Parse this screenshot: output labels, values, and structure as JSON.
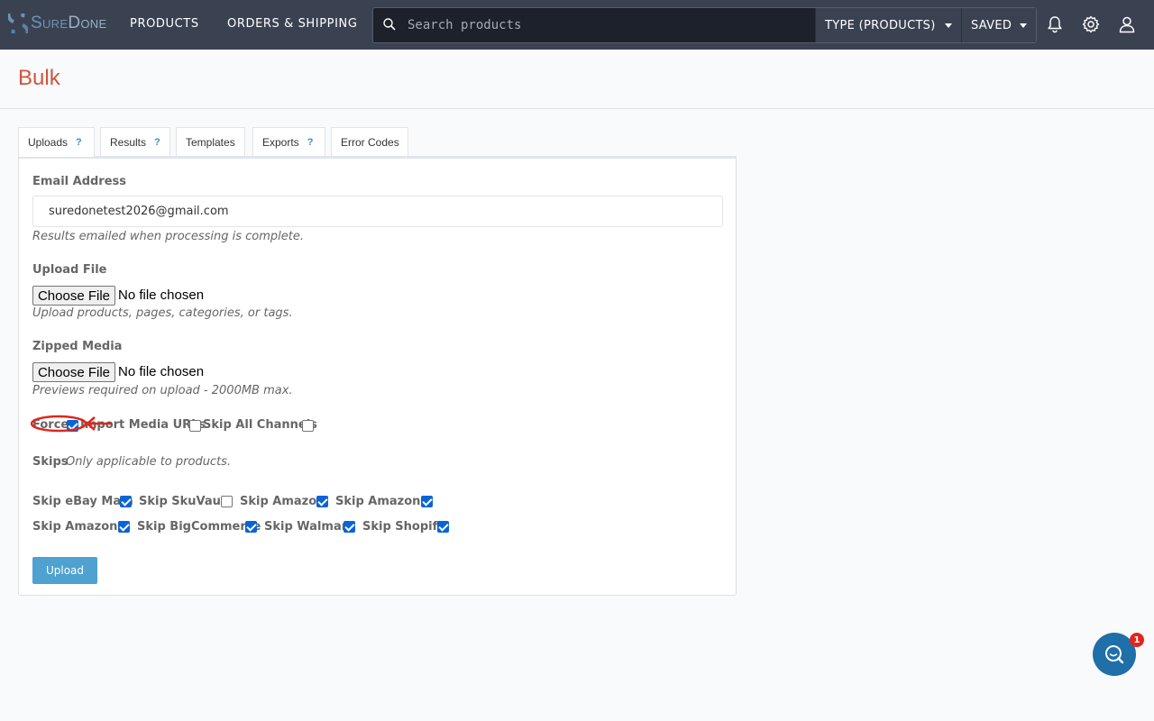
{
  "brand": {
    "name_part1": "Sure",
    "name_part2": "Done"
  },
  "nav": {
    "items": [
      {
        "label": "PRODUCTS"
      },
      {
        "label": "ORDERS & SHIPPING"
      }
    ],
    "search": {
      "placeholder": "Search products",
      "value": ""
    },
    "type_dropdown": {
      "label": "TYPE (PRODUCTS)"
    },
    "saved_dropdown": {
      "label": "SAVED"
    },
    "icons": [
      "bell-icon",
      "gear-icon",
      "user-icon"
    ]
  },
  "page": {
    "title": "Bulk"
  },
  "tabs": [
    {
      "label": "Uploads",
      "help": "?"
    },
    {
      "label": "Results",
      "help": "?"
    },
    {
      "label": "Templates"
    },
    {
      "label": "Exports",
      "help": "?"
    },
    {
      "label": "Error Codes"
    }
  ],
  "form": {
    "email": {
      "label": "Email Address",
      "value": "suredonetest2026@gmail.com",
      "help": "Results emailed when processing is complete."
    },
    "upload_file": {
      "label": "Upload File",
      "button": "Choose File",
      "status": "No file chosen",
      "help": "Upload products, pages, categories, or tags."
    },
    "zipped_media": {
      "label": "Zipped Media",
      "button": "Choose File",
      "status": "No file chosen",
      "help": "Previews required on upload - 2000MB max."
    },
    "options": [
      {
        "label": "Force",
        "checked": true
      },
      {
        "label": "Import Media URLs",
        "checked": false
      },
      {
        "label": "Skip All Channels",
        "checked": false
      }
    ],
    "skips": {
      "label": "Skips",
      "help": "Only applicable to products.",
      "items": [
        {
          "label": "Skip eBay Main",
          "checked": true
        },
        {
          "label": "Skip SkuVault",
          "checked": false
        },
        {
          "label": "Skip Amazon",
          "checked": true
        },
        {
          "label": "Skip Amazon 2",
          "checked": true
        },
        {
          "label": "Skip Amazon 3",
          "checked": true
        },
        {
          "label": "Skip BigCommerce",
          "checked": true
        },
        {
          "label": "Skip Walmart",
          "checked": true
        },
        {
          "label": "Skip Shopify",
          "checked": true
        }
      ]
    },
    "submit": {
      "label": "Upload"
    }
  },
  "chat": {
    "badge_count": "1"
  },
  "colors": {
    "nav_bg": "#3a4252",
    "title": "#d0553c",
    "accent": "#4fa1cf",
    "checkbox_on": "#0a64d6",
    "annotation": "#e0261d"
  }
}
